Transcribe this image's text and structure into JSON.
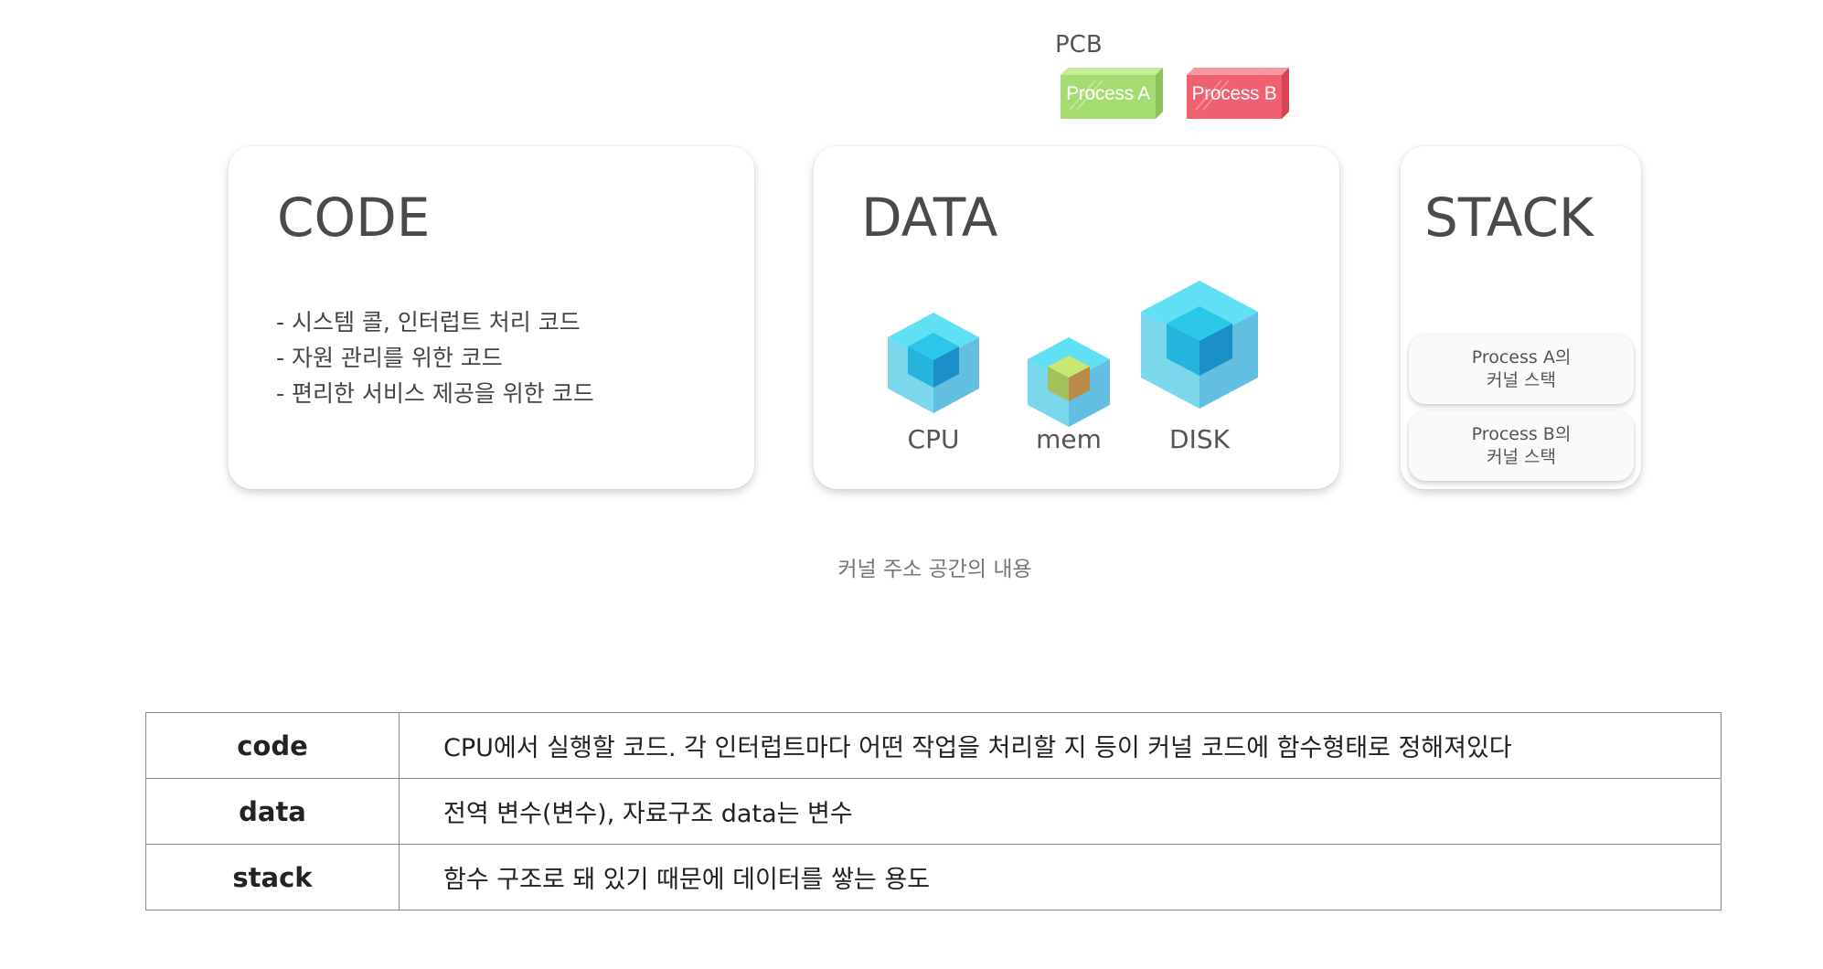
{
  "pcb": {
    "label": "PCB",
    "processes": [
      {
        "label": "Process A",
        "color": "#a5dc72"
      },
      {
        "label": "Process B",
        "color": "#ef6070"
      }
    ]
  },
  "code_card": {
    "title": "CODE",
    "lines": [
      "- 시스템 콜, 인터럽트 처리 코드",
      "- 자원 관리를 위한 코드",
      "- 편리한 서비스 제공을 위한 코드"
    ]
  },
  "data_card": {
    "title": "DATA",
    "items": [
      {
        "label": "CPU",
        "icon": "cube-icon"
      },
      {
        "label": "mem",
        "icon": "cube-icon"
      },
      {
        "label": "DISK",
        "icon": "cube-icon"
      }
    ]
  },
  "stack_card": {
    "title": "STACK",
    "entries": [
      {
        "line1": "Process A의",
        "line2": "커널 스택"
      },
      {
        "line1": "Process B의",
        "line2": "커널 스택"
      }
    ]
  },
  "caption": "커널 주소 공간의 내용",
  "table": {
    "rows": [
      {
        "term": "code",
        "desc": "CPU에서 실행할 코드. 각 인터럽트마다 어떤 작업을 처리할 지 등이 커널 코드에 함수형태로 정해져있다"
      },
      {
        "term": "data",
        "desc": "전역 변수(변수), 자료구조 data는 변수"
      },
      {
        "term": "stack",
        "desc": "함수 구조로 돼 있기 때문에 데이터를 쌓는 용도"
      }
    ]
  },
  "colors": {
    "cube_outer_top": "#5fe0f4",
    "cube_outer_left": "#7bd7ec",
    "cube_outer_right": "#62bfe2",
    "cube_inner": "#1fa6d8",
    "mem_core_top": "#c8e872",
    "mem_core_side": "#b98a4c"
  }
}
